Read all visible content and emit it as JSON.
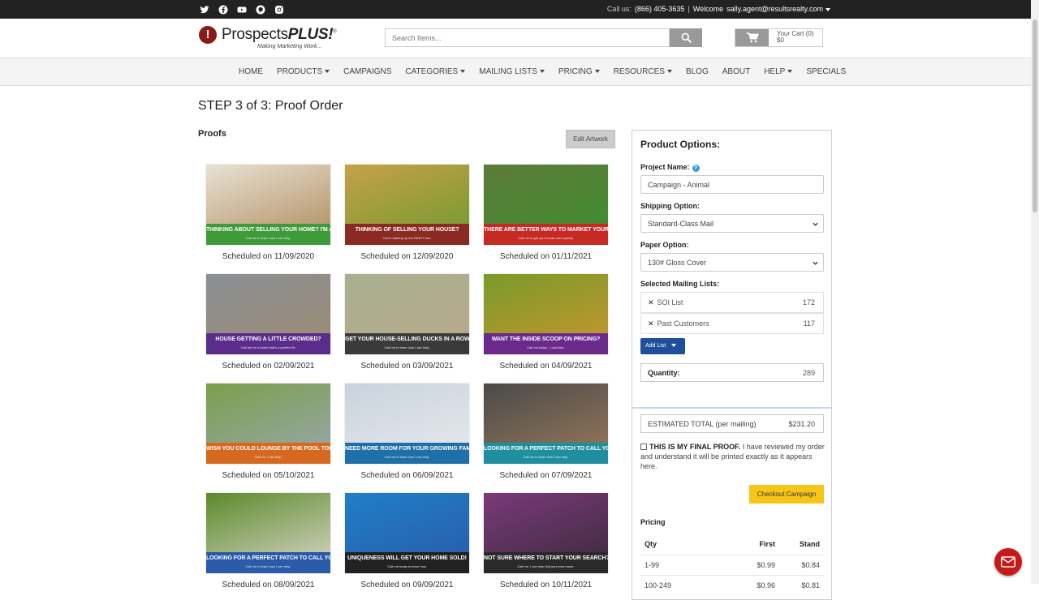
{
  "topbar": {
    "social_icons": [
      "twitter-icon",
      "facebook-icon",
      "youtube-icon",
      "pinterest-icon",
      "instagram-icon"
    ],
    "call_label": "Call us:",
    "phone": "(866) 405-3635",
    "separator": "|",
    "welcome_label": "Welcome",
    "user_email": "sally.agent@resultsrealty.com"
  },
  "header": {
    "logo_mark": "!",
    "logo_word_a": "Prospects",
    "logo_word_b": "PLUS!",
    "logo_reg": "®",
    "logo_tagline": "Making Marketing Work...",
    "search_placeholder": "Search Items...",
    "cart_label": "Your Cart (0)",
    "cart_total": "$0"
  },
  "nav": {
    "items": [
      {
        "label": "HOME",
        "dropdown": false
      },
      {
        "label": "PRODUCTS",
        "dropdown": true
      },
      {
        "label": "CAMPAIGNS",
        "dropdown": false
      },
      {
        "label": "CATEGORIES",
        "dropdown": true
      },
      {
        "label": "MAILING LISTS",
        "dropdown": true
      },
      {
        "label": "PRICING",
        "dropdown": true
      },
      {
        "label": "RESOURCES",
        "dropdown": true
      },
      {
        "label": "BLOG",
        "dropdown": false
      },
      {
        "label": "ABOUT",
        "dropdown": false
      },
      {
        "label": "HELP",
        "dropdown": true
      },
      {
        "label": "SPECIALS",
        "dropdown": false
      }
    ]
  },
  "main": {
    "step_title": "STEP 3 of 3: Proof Order",
    "proofs_label": "Proofs",
    "edit_artwork_label": "Edit Artwork",
    "proofs": [
      {
        "headline": "THINKING ABOUT SELLING YOUR HOME? I'M ALL EARS!",
        "sub": "Call me to learn how I can help.",
        "caption": "Scheduled on 11/09/2020",
        "band": "#3f9a3a",
        "bg1": "#e8e2d4",
        "bg2": "#b08a5c"
      },
      {
        "headline": "THINKING OF SELLING YOUR HOUSE?",
        "sub": "You're barking up the RIGHT tree.",
        "caption": "Scheduled on 12/09/2020",
        "band": "#8a2a22",
        "bg1": "#c7a04a",
        "bg2": "#6f9a2c"
      },
      {
        "headline": "THERE ARE BETTER WAYS TO MARKET YOUR HOME.",
        "sub": "Call me to get your house sold quickly.",
        "caption": "Scheduled on 01/11/2021",
        "band": "#c52a24",
        "bg1": "#5d7a3a",
        "bg2": "#3f8f2e"
      },
      {
        "headline": "HOUSE GETTING A LITTLE CROWDED?",
        "sub": "Call me for a home that's a purrfect fit.",
        "caption": "Scheduled on 02/09/2021",
        "band": "#5a2d8c",
        "bg1": "#8a8f96",
        "bg2": "#9c8a70"
      },
      {
        "headline": "GET YOUR HOUSE-SELLING DUCKS IN A ROW!",
        "sub": "Call me to learn how I can help.",
        "caption": "Scheduled on 03/09/2021",
        "band": "#3a3a3a",
        "bg1": "#a8b090",
        "bg2": "#b8a98a"
      },
      {
        "headline": "WANT THE INSIDE SCOOP ON PRICING?",
        "sub": "Call me today - I can help.",
        "caption": "Scheduled on 04/09/2021",
        "band": "#6a2a8c",
        "bg1": "#7a9a2a",
        "bg2": "#c8962e"
      },
      {
        "headline": "WISH YOU COULD LOUNGE BY THE POOL TODAY?",
        "sub": "Call me, I can help.",
        "caption": "Scheduled on 05/10/2021",
        "band": "#d6691f",
        "bg1": "#7aa04a",
        "bg2": "#9aa6b0"
      },
      {
        "headline": "NEED MORE ROOM FOR YOUR GROWING FAMILY?",
        "sub": "Call me to learn how I can help.",
        "caption": "Scheduled on 06/09/2021",
        "band": "#1f6fa8",
        "bg1": "#c9d3dc",
        "bg2": "#e8eaee"
      },
      {
        "headline": "LOOKING FOR A PERFECT PATCH TO CALL YOUR OWN?",
        "sub": "Call me to learn how I can help.",
        "caption": "Scheduled on 07/09/2021",
        "band": "#1f8fa0",
        "bg1": "#4a4a4a",
        "bg2": "#9a7a5a"
      },
      {
        "headline": "LOOKING FOR A PERFECT PATCH TO CALL YOUR OWN?",
        "sub": "Call me to learn how I can help.",
        "caption": "Scheduled on 08/09/2021",
        "band": "#2a5aa8",
        "bg1": "#5a8a2a",
        "bg2": "#dcd8cc"
      },
      {
        "headline": "UNIQUENESS WILL GET YOUR HOME SOLD!",
        "sub": "Call me today to learn how.",
        "caption": "Scheduled on 09/09/2021",
        "band": "#222222",
        "bg1": "#1f7fc8",
        "bg2": "#2a5aa8"
      },
      {
        "headline": "NOT SURE WHERE TO START YOUR SEARCH?",
        "sub": "Call me, I can help find your new home.",
        "caption": "Scheduled on 10/11/2021",
        "band": "#2a2a2a",
        "bg1": "#7a3a7a",
        "bg2": "#3a2a3a"
      }
    ]
  },
  "panel": {
    "title": "Product Options:",
    "project_name_label": "Project Name:",
    "help_glyph": "?",
    "project_name_value": "Campaign - Animal",
    "shipping_label": "Shipping Option:",
    "shipping_value": "Standard-Class Mail",
    "paper_label": "Paper Option:",
    "paper_value": "130# Gloss Cover",
    "mailing_lists_label": "Selected Mailing Lists:",
    "mailing_lists": [
      {
        "name": "SOI List",
        "count": "172"
      },
      {
        "name": "Past Customers",
        "count": "117"
      }
    ],
    "remove_glyph": "✕",
    "add_list_label": "Add List",
    "quantity_label": "Quantity:",
    "quantity_value": "289",
    "estimated_label": "ESTIMATED TOTAL (per mailing)",
    "estimated_value": "$231.20",
    "final_proof_bold": "THIS IS MY FINAL PROOF.",
    "final_proof_text": " I have reviewed my order and understand it will be printed exactly as it appears here.",
    "checkout_label": "Checkout Campaign",
    "pricing_label": "Pricing",
    "pricing_headers": [
      "Qty",
      "First",
      "Stand"
    ],
    "pricing_rows": [
      [
        "1-99",
        "$0.99",
        "$0.84"
      ],
      [
        "100-249",
        "$0.96",
        "$0.81"
      ]
    ]
  },
  "colors": {
    "topbar_bg": "#222222",
    "accent_blue": "#1f4f9a",
    "checkout_yellow": "#f5c518",
    "logo_red": "#8b1a1a",
    "chat_red": "#c8191a"
  }
}
